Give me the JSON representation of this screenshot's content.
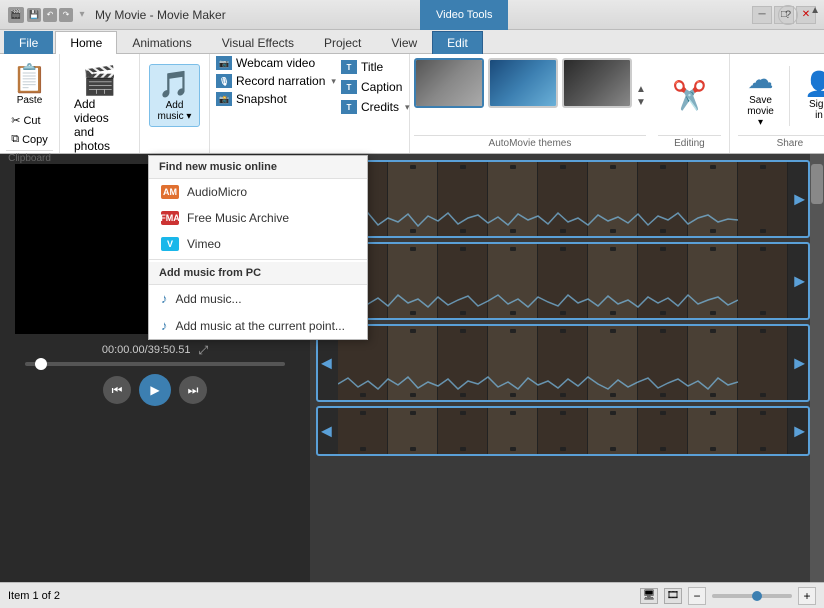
{
  "titleBar": {
    "appTitle": "My Movie - Movie Maker",
    "videoToolsTab": "Video Tools",
    "windowControls": {
      "minimize": "─",
      "maximize": "□",
      "close": "✕"
    }
  },
  "ribbonTabs": {
    "file": "File",
    "home": "Home",
    "animations": "Animations",
    "visualEffects": "Visual Effects",
    "project": "Project",
    "view": "View",
    "edit": "Edit"
  },
  "ribbon": {
    "clipboard": {
      "label": "Clipboard",
      "paste": "Paste",
      "cut": "Cut",
      "copy": "Copy"
    },
    "addVideos": {
      "label": "Add videos\nand photos",
      "line1": "Add videos",
      "line2": "and photos"
    },
    "addMusic": {
      "label": "Add\nmusic",
      "line1": "Add",
      "line2": "music"
    },
    "textTools": {
      "webcamVideo": "Webcam video",
      "recordNarration": "Record narration",
      "snapshot": "Snapshot",
      "title": "Title",
      "caption": "Caption",
      "credits": "Credits"
    },
    "autoMovieThemes": {
      "label": "AutoMovie themes"
    },
    "editing": {
      "label": "Editing"
    },
    "share": {
      "label": "Share",
      "saveMovie": "Save\nmovie",
      "signIn": "Sign\nin"
    }
  },
  "dropdown": {
    "findNewMusicOnline": "Find new music online",
    "items": [
      {
        "icon": "AM",
        "iconClass": "icon-audiomicro",
        "label": "AudioMicro"
      },
      {
        "icon": "FMA",
        "iconClass": "icon-fma",
        "label": "Free Music Archive"
      },
      {
        "icon": "V",
        "iconClass": "icon-vimeo",
        "label": "Vimeo"
      }
    ],
    "addMusicFromPC": "Add music from PC",
    "addMusic": "Add music...",
    "addMusicAtCurrentPoint": "Add music at the current point..."
  },
  "statusBar": {
    "itemCount": "Item 1 of 2",
    "zoomMinus": "−",
    "zoomPlus": "+"
  },
  "timeDisplay": "00:00.00/39:50.51",
  "preview": {
    "expandIcon": "⤢"
  }
}
